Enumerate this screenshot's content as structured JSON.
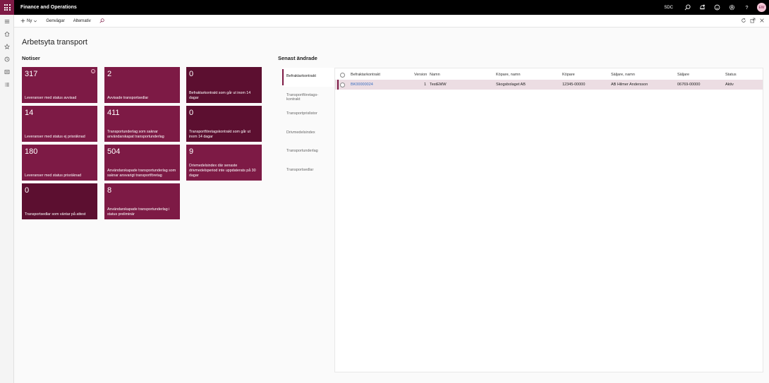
{
  "topbar": {
    "app_title": "Finance and Operations",
    "company": "SDC",
    "avatar_initials": "EW"
  },
  "actionbar": {
    "new_label": "Ny",
    "shortcuts_label": "Genvägar",
    "options_label": "Alternativ"
  },
  "page_title": "Arbetsyta transport",
  "notices": {
    "title": "Notiser",
    "tiles": [
      {
        "count": "317",
        "label": "Leveranser med status avvisad"
      },
      {
        "count": "2",
        "label": "Avvisade transportsedlar"
      },
      {
        "count": "0",
        "label": "Befraktarkontrakt som går ut inom 14 dagar"
      },
      {
        "count": "14",
        "label": "Leveranser med status ej prisräknad"
      },
      {
        "count": "411",
        "label": "Transportunderlag som saknar användarskapat transportunderlag"
      },
      {
        "count": "0",
        "label": "Transportföretagskontrakt som går ut inom 14 dagar"
      },
      {
        "count": "180",
        "label": "Leveranser med status prisräknad"
      },
      {
        "count": "504",
        "label": "Användarskapade transportunderlag som saknar ansvarigt transportföretag"
      },
      {
        "count": "9",
        "label": "Drivmedelsindex där senaste drivmedelsperiod inte uppdaterats på 30 dagar"
      },
      {
        "count": "0",
        "label": "Transportsedlar som väntar på attest"
      },
      {
        "count": "8",
        "label": "Användarskapade transportunderlag i status preliminär"
      }
    ]
  },
  "recent": {
    "title": "Senast ändrade",
    "tabs": [
      {
        "label": "Befraktarkontrakt"
      },
      {
        "label": "Transportföretags-kontrakt"
      },
      {
        "label": "Transportprislistor"
      },
      {
        "label": "Drivmedelsindex"
      },
      {
        "label": "Transportunderlag"
      },
      {
        "label": "Transportsedlar"
      }
    ],
    "columns": [
      "Befraktarkontrakt",
      "Version",
      "Namn",
      "Köpare, namn",
      "Köpare",
      "Säljare, namn",
      "Säljare",
      "Status"
    ],
    "rows": [
      {
        "contract": "BK00000024",
        "version": "1",
        "name": "TestEMW",
        "buyer_name": "Skogsbolaget AB",
        "buyer": "12345-00000",
        "seller_name": "AB Hilmer Andersson",
        "seller": "06769-00000",
        "status": "Aktiv"
      }
    ]
  },
  "colors": {
    "accent": "#7d1a45",
    "accent_dark": "#5c0f30",
    "link": "#3a6fc2"
  }
}
